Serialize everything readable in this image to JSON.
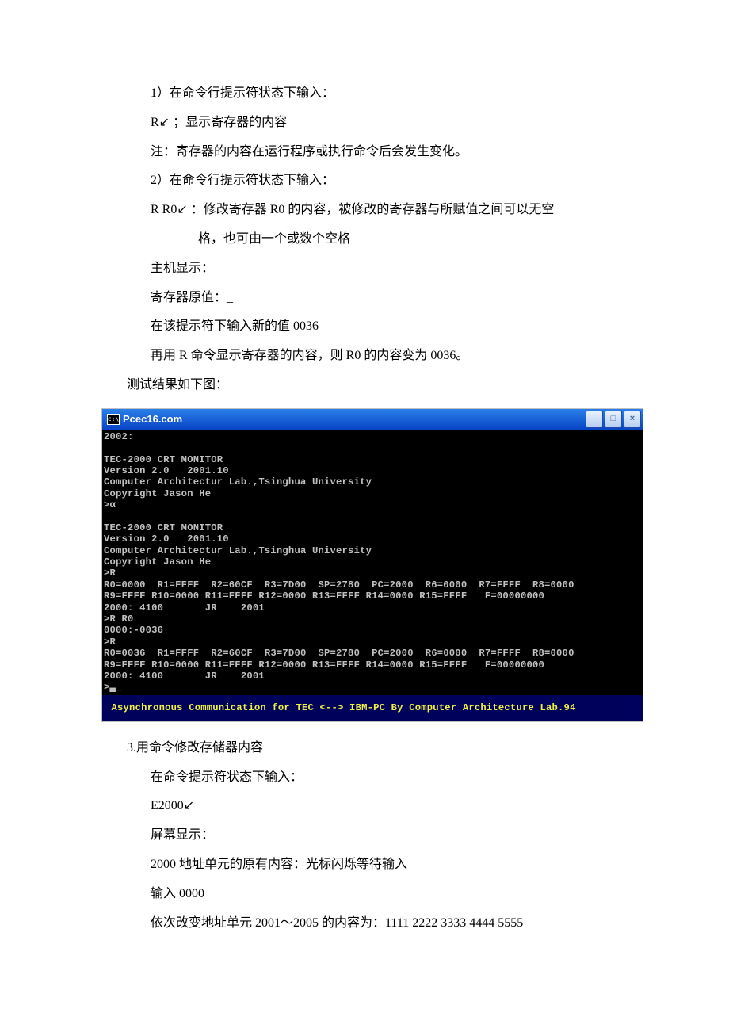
{
  "section1": {
    "line1": "1）在命令行提示符状态下输入：",
    "line2_a": "R",
    "line2_enter": "↙",
    "line2_b": "         ；显示寄存器的内容",
    "line3": "注：寄存器的内容在运行程序或执行命令后会发生变化。",
    "line4": "2）在命令行提示符状态下输入：",
    "line5_a": "R R0",
    "line5_enter": "↙",
    "line5_b": " ：修改寄存器 R0 的内容，被修改的寄存器与所赋值之间可以无空",
    "line6": "格，也可由一个或数个空格",
    "line7": "主机显示：",
    "line8": "寄存器原值：_",
    "line9": "在该提示符下输入新的值 0036",
    "line10": "再用 R 命令显示寄存器的内容，则 R0 的内容变为 0036。",
    "line11": "测试结果如下图："
  },
  "terminal": {
    "title": "Pcec16.com",
    "icon_text": "c:\\",
    "body_lines": [
      "2002:",
      "",
      "TEC-2000 CRT MONITOR",
      "Version 2.0   2001.10",
      "Computer Architectur Lab.,Tsinghua University",
      "Copyright Jason He",
      ">α",
      "",
      "TEC-2000 CRT MONITOR",
      "Version 2.0   2001.10",
      "Computer Architectur Lab.,Tsinghua University",
      "Copyright Jason He",
      ">R",
      "R0=0000  R1=FFFF  R2=60CF  R3=7D00  SP=2780  PC=2000  R6=0000  R7=FFFF  R8=0000",
      "R9=FFFF R10=0000 R11=FFFF R12=0000 R13=FFFF R14=0000 R15=FFFF   F=00000000",
      "2000: 4100       JR    2001",
      ">R R0",
      "0000:-0036",
      ">R",
      "R0=0036  R1=FFFF  R2=60CF  R3=7D00  SP=2780  PC=2000  R6=0000  R7=FFFF  R8=0000",
      "R9=FFFF R10=0000 R11=FFFF R12=0000 R13=FFFF R14=0000 R15=FFFF   F=00000000",
      "2000: 4100       JR    2001",
      ">▃_"
    ],
    "status": " Asynchronous Communication for TEC <--> IBM-PC By Computer Architecture Lab.94"
  },
  "section2": {
    "line1": "3.用命令修改存储器内容",
    "line2": "在命令提示符状态下输入：",
    "line3_a": "E2000",
    "line3_enter": "↙",
    "line4": "屏幕显示：",
    "line5": "2000 地址单元的原有内容：光标闪烁等待输入",
    "line6": "输入 0000",
    "line7": "依次改变地址单元 2001～2005 的内容为：1111 2222 3333 4444 5555"
  }
}
